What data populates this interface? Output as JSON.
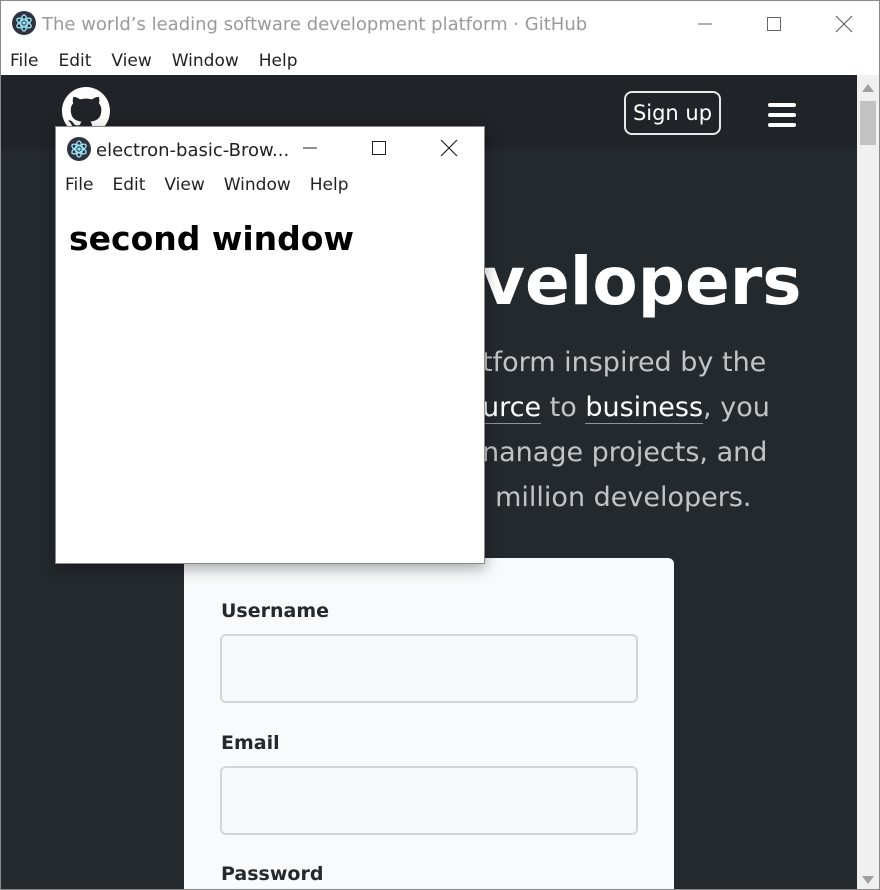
{
  "main_window": {
    "title": "The world’s leading software development platform · GitHub",
    "menu": [
      "File",
      "Edit",
      "View",
      "Window",
      "Help"
    ],
    "controls": {
      "minimize": "minimize-icon",
      "maximize": "maximize-icon",
      "close": "close-icon"
    }
  },
  "page": {
    "header": {
      "signup_label": "Sign up",
      "logo": "github-logo",
      "menu_icon": "hamburger-icon"
    },
    "hero": {
      "title_visible": "velopers",
      "line1": "tform inspired by the",
      "line2_a": "urce",
      "line2_b": " to ",
      "line2_link": "business",
      "line2_c": ", you",
      "line3": "nanage projects, and",
      "line4": ") million developers."
    },
    "form": {
      "username_label": "Username",
      "username_value": "",
      "email_label": "Email",
      "email_value": "",
      "password_label": "Password"
    }
  },
  "child_window": {
    "title": "electron-basic-Brow...",
    "menu": [
      "File",
      "Edit",
      "View",
      "Window",
      "Help"
    ],
    "heading": "second window"
  },
  "colors": {
    "page_bg": "#24292e",
    "header_bg": "#202327",
    "card_bg": "#f9fafb"
  }
}
